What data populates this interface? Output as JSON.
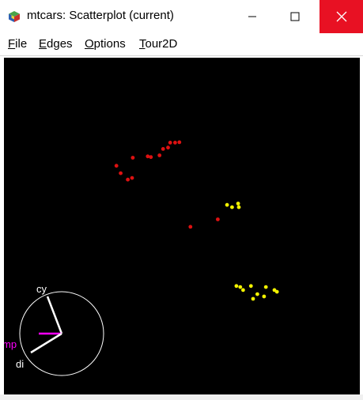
{
  "window": {
    "title": "mtcars: Scatterplot (current)"
  },
  "menu": {
    "items": [
      "File",
      "Edges",
      "Options",
      "Tour2D"
    ]
  },
  "colors": {
    "plot_background": "#000000",
    "cluster_red": "#dd1111",
    "cluster_yellow": "#f2f200",
    "axis_line": "#ffffff",
    "axis_highlight": "#ff00ff",
    "close_button": "#e81123"
  },
  "tour_axes": {
    "labels": {
      "cy": "cy",
      "mp": "mp",
      "di": "di"
    }
  },
  "chart_data": {
    "type": "scatter",
    "points": [
      {
        "x": 0.316,
        "y": 0.679,
        "color": "red"
      },
      {
        "x": 0.328,
        "y": 0.657,
        "color": "red"
      },
      {
        "x": 0.348,
        "y": 0.638,
        "color": "red"
      },
      {
        "x": 0.36,
        "y": 0.643,
        "color": "red"
      },
      {
        "x": 0.362,
        "y": 0.703,
        "color": "red"
      },
      {
        "x": 0.404,
        "y": 0.707,
        "color": "red"
      },
      {
        "x": 0.413,
        "y": 0.705,
        "color": "red"
      },
      {
        "x": 0.437,
        "y": 0.71,
        "color": "red"
      },
      {
        "x": 0.447,
        "y": 0.729,
        "color": "red"
      },
      {
        "x": 0.461,
        "y": 0.733,
        "color": "red"
      },
      {
        "x": 0.467,
        "y": 0.748,
        "color": "red"
      },
      {
        "x": 0.481,
        "y": 0.748,
        "color": "red"
      },
      {
        "x": 0.493,
        "y": 0.749,
        "color": "red"
      },
      {
        "x": 0.524,
        "y": 0.498,
        "color": "red"
      },
      {
        "x": 0.601,
        "y": 0.52,
        "color": "red"
      },
      {
        "x": 0.627,
        "y": 0.563,
        "color": "yellow"
      },
      {
        "x": 0.641,
        "y": 0.556,
        "color": "yellow"
      },
      {
        "x": 0.658,
        "y": 0.567,
        "color": "yellow"
      },
      {
        "x": 0.66,
        "y": 0.556,
        "color": "yellow"
      },
      {
        "x": 0.653,
        "y": 0.322,
        "color": "yellow"
      },
      {
        "x": 0.664,
        "y": 0.319,
        "color": "yellow"
      },
      {
        "x": 0.672,
        "y": 0.31,
        "color": "yellow"
      },
      {
        "x": 0.694,
        "y": 0.322,
        "color": "yellow"
      },
      {
        "x": 0.7,
        "y": 0.284,
        "color": "yellow"
      },
      {
        "x": 0.712,
        "y": 0.298,
        "color": "yellow"
      },
      {
        "x": 0.731,
        "y": 0.291,
        "color": "yellow"
      },
      {
        "x": 0.736,
        "y": 0.319,
        "color": "yellow"
      },
      {
        "x": 0.76,
        "y": 0.31,
        "color": "yellow"
      },
      {
        "x": 0.767,
        "y": 0.305,
        "color": "yellow"
      }
    ],
    "axes_visible": false,
    "grid": false
  }
}
